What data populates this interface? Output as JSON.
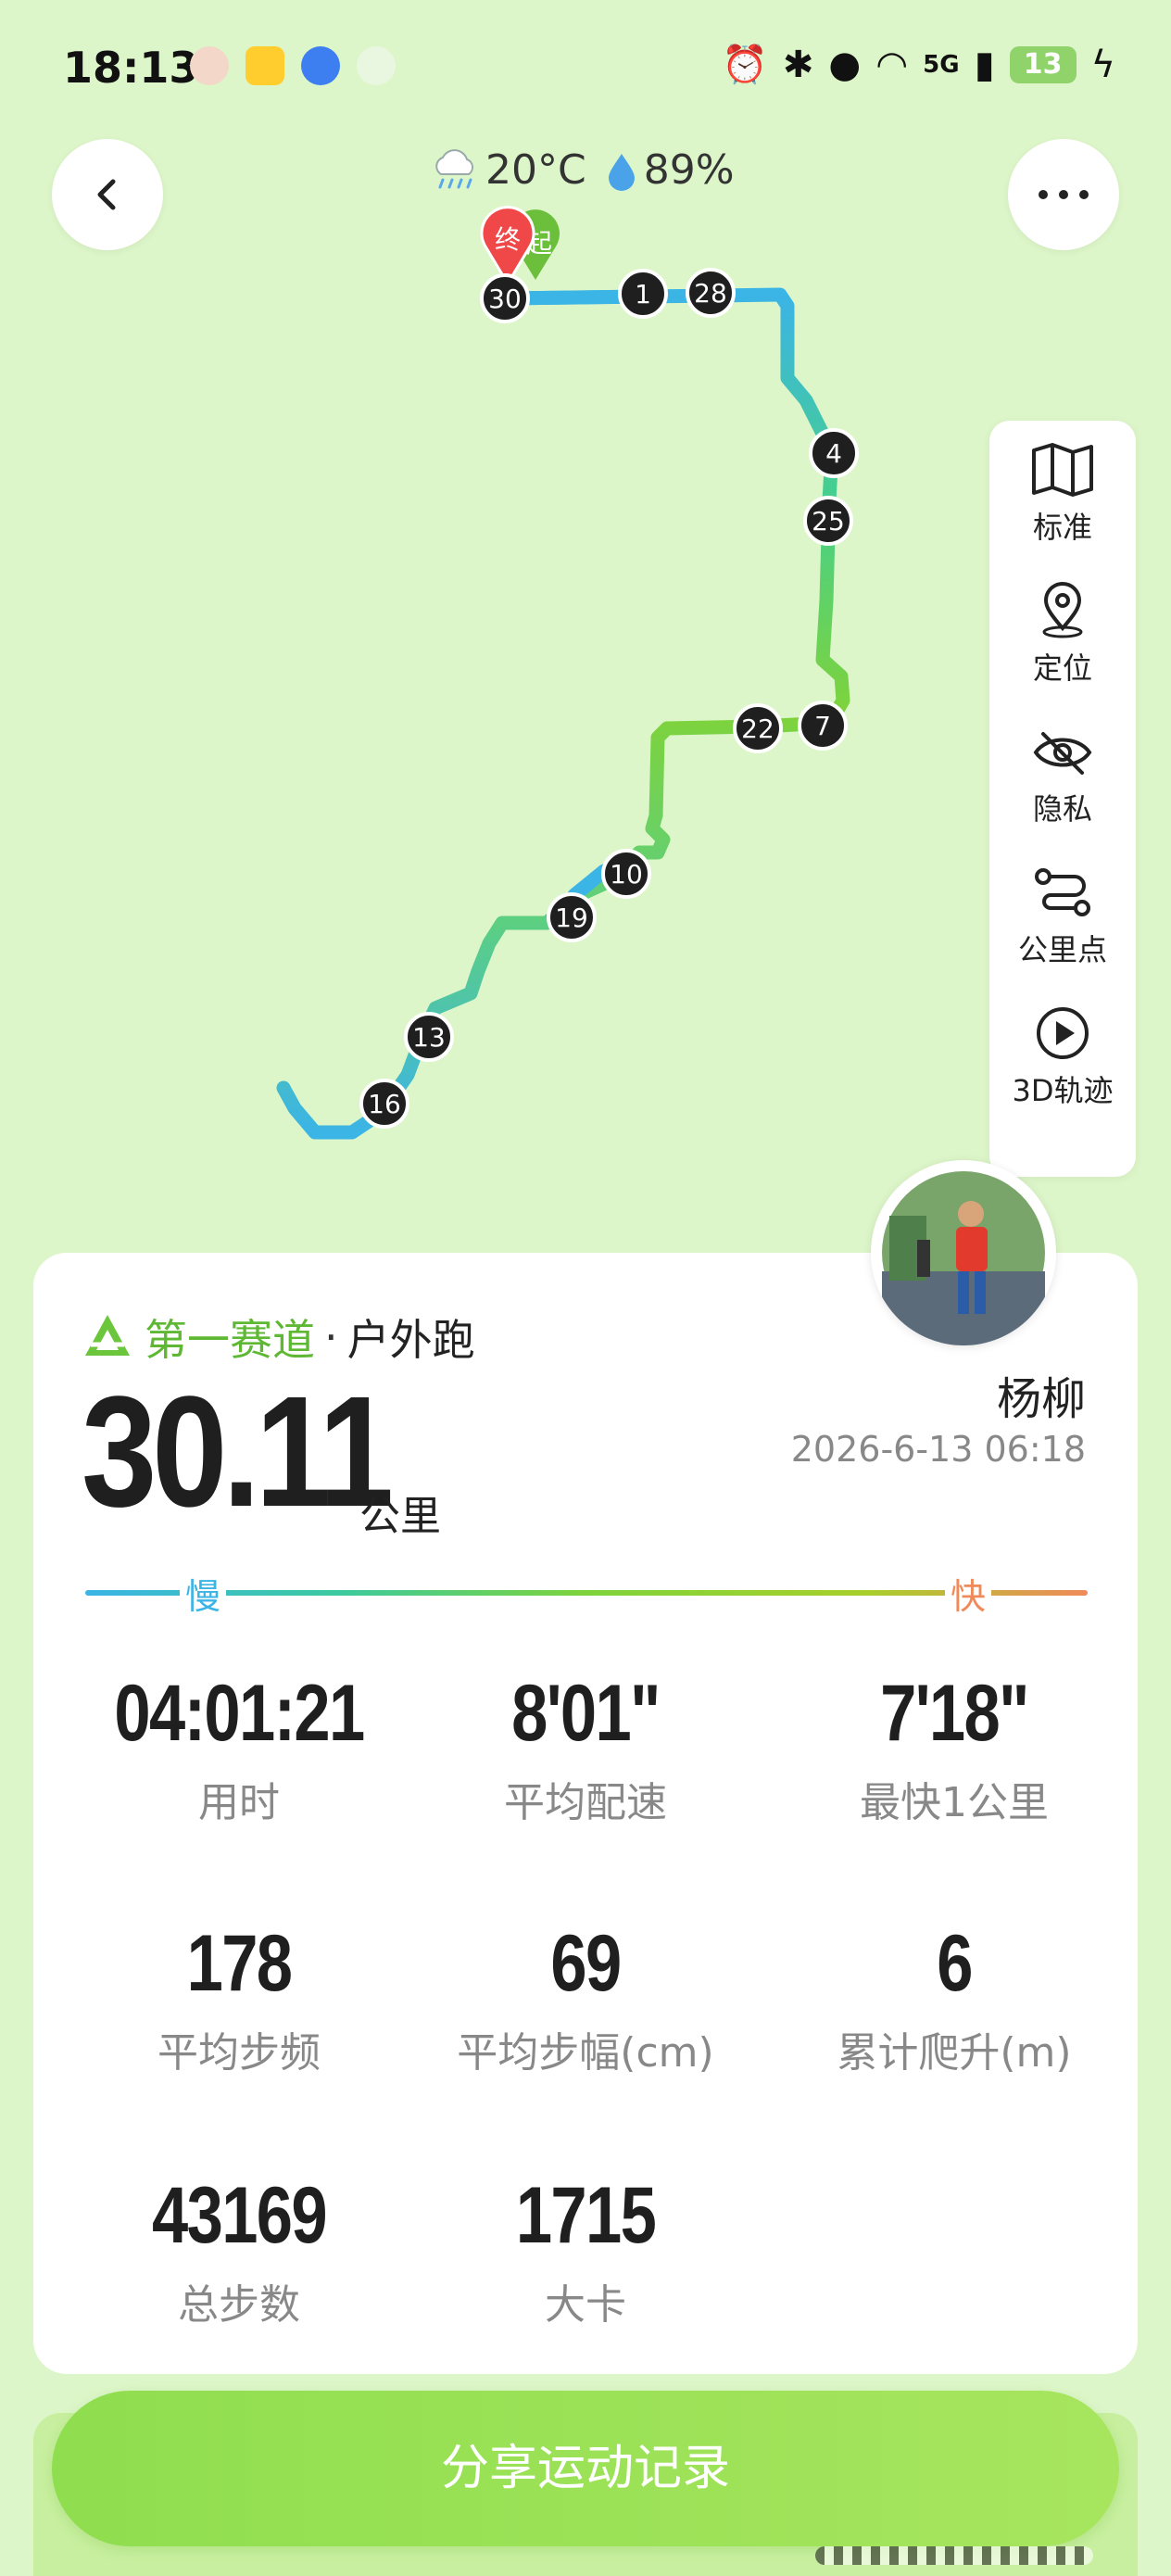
{
  "status_bar": {
    "time": "18:13",
    "network": "5G",
    "battery": "13"
  },
  "weather": {
    "temperature": "20°C",
    "humidity": "89%"
  },
  "map": {
    "start_label": "起",
    "end_label": "终",
    "km_markers": [
      "30",
      "1",
      "28",
      "4",
      "25",
      "22",
      "7",
      "10",
      "19",
      "13",
      "16"
    ],
    "tools": [
      {
        "label": "标准",
        "icon": "map-icon"
      },
      {
        "label": "定位",
        "icon": "location-pin-icon"
      },
      {
        "label": "隐私",
        "icon": "eye-off-icon"
      },
      {
        "label": "公里点",
        "icon": "route-points-icon"
      },
      {
        "label": "3D轨迹",
        "icon": "play-icon"
      }
    ]
  },
  "summary": {
    "brand": "第一赛道",
    "separator": "·",
    "sport_type": "户外跑",
    "distance": "30.11",
    "distance_unit": "公里",
    "user_name": "杨柳",
    "date_time": "2026-6-13 06:18",
    "speed_slow": "慢",
    "speed_fast": "快"
  },
  "stats": [
    {
      "value": "04:01:21",
      "label": "用时"
    },
    {
      "value": "8'01\"",
      "label": "平均配速"
    },
    {
      "value": "7'18\"",
      "label": "最快1公里"
    },
    {
      "value": "178",
      "label": "平均步频"
    },
    {
      "value": "69",
      "label": "平均步幅(cm)"
    },
    {
      "value": "6",
      "label": "累计爬升(m)"
    },
    {
      "value": "43169",
      "label": "总步数"
    },
    {
      "value": "1715",
      "label": "大卡"
    }
  ],
  "share_button": "分享运动记录",
  "colors": {
    "background": "#ddf6c9",
    "brand_green": "#5fb833",
    "slow": "#3bb4e6",
    "fast": "#f08a5a",
    "end_marker": "#f04848",
    "start_marker": "#6cbf3a"
  }
}
